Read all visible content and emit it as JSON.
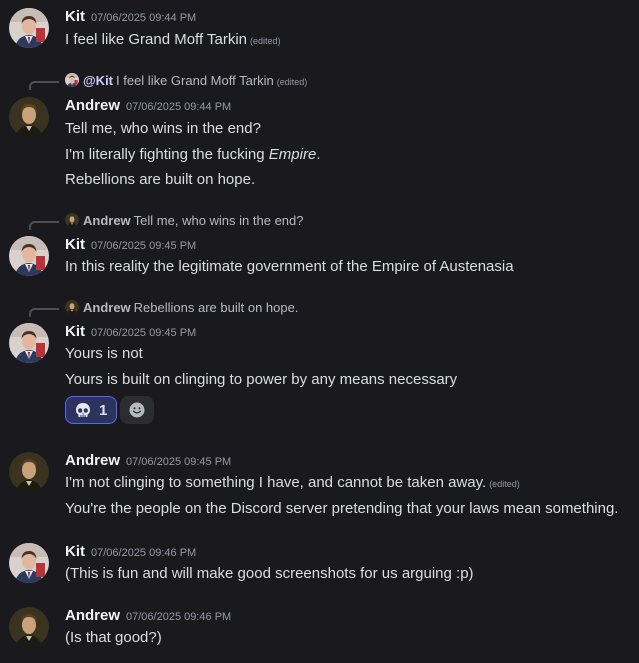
{
  "users": {
    "kit": {
      "name": "Kit"
    },
    "andrew": {
      "name": "Andrew"
    }
  },
  "messages": [
    {
      "author": "Kit",
      "timestamp": "07/06/2025 09:44 PM",
      "lines": [
        {
          "text": "I feel like Grand Moff Tarkin",
          "edited": "(edited)"
        }
      ]
    },
    {
      "reply": {
        "mention": "@Kit",
        "text": "I feel like Grand Moff Tarkin",
        "edited": "(edited)"
      },
      "author": "Andrew",
      "timestamp": "07/06/2025 09:44 PM",
      "lines": [
        {
          "text": "Tell me, who wins in the end?"
        },
        {
          "text_before": "I'm literally fighting the fucking ",
          "text_em": "Empire",
          "text_after": "."
        },
        {
          "text": "Rebellions are built on hope."
        }
      ]
    },
    {
      "reply": {
        "name": "Andrew",
        "text": "Tell me, who wins in the end?"
      },
      "author": "Kit",
      "timestamp": "07/06/2025 09:45 PM",
      "lines": [
        {
          "text": "In this reality the legitimate government of the Empire of Austenasia"
        }
      ]
    },
    {
      "reply": {
        "name": "Andrew",
        "text": "Rebellions are built on hope."
      },
      "author": "Kit",
      "timestamp": "07/06/2025 09:45 PM",
      "lines": [
        {
          "text": "Yours is not"
        },
        {
          "text": "Yours is built on clinging to power by any means necessary"
        }
      ],
      "reactions": [
        {
          "emoji": "skull-icon",
          "count": "1",
          "active": true
        }
      ]
    },
    {
      "author": "Andrew",
      "timestamp": "07/06/2025 09:45 PM",
      "lines": [
        {
          "text": "I'm not clinging to something I have, and cannot be taken away.",
          "edited": "(edited)"
        },
        {
          "text": "You're the people on the Discord server pretending that your laws mean something."
        }
      ]
    },
    {
      "author": "Kit",
      "timestamp": "07/06/2025 09:46 PM",
      "lines": [
        {
          "text": "(This is fun and will make good screenshots for us arguing :p)"
        }
      ]
    },
    {
      "author": "Andrew",
      "timestamp": "07/06/2025 09:46 PM",
      "lines": [
        {
          "text": "(Is that good?)"
        }
      ]
    }
  ],
  "colors": {
    "background": "#1a1a1e",
    "username": "#f2f3f5",
    "text": "#dbdee1",
    "muted": "#949ba4",
    "mention": "#c9cdfb",
    "reaction_active_bg": "#2d3361",
    "reaction_active_border": "#5865f2"
  }
}
